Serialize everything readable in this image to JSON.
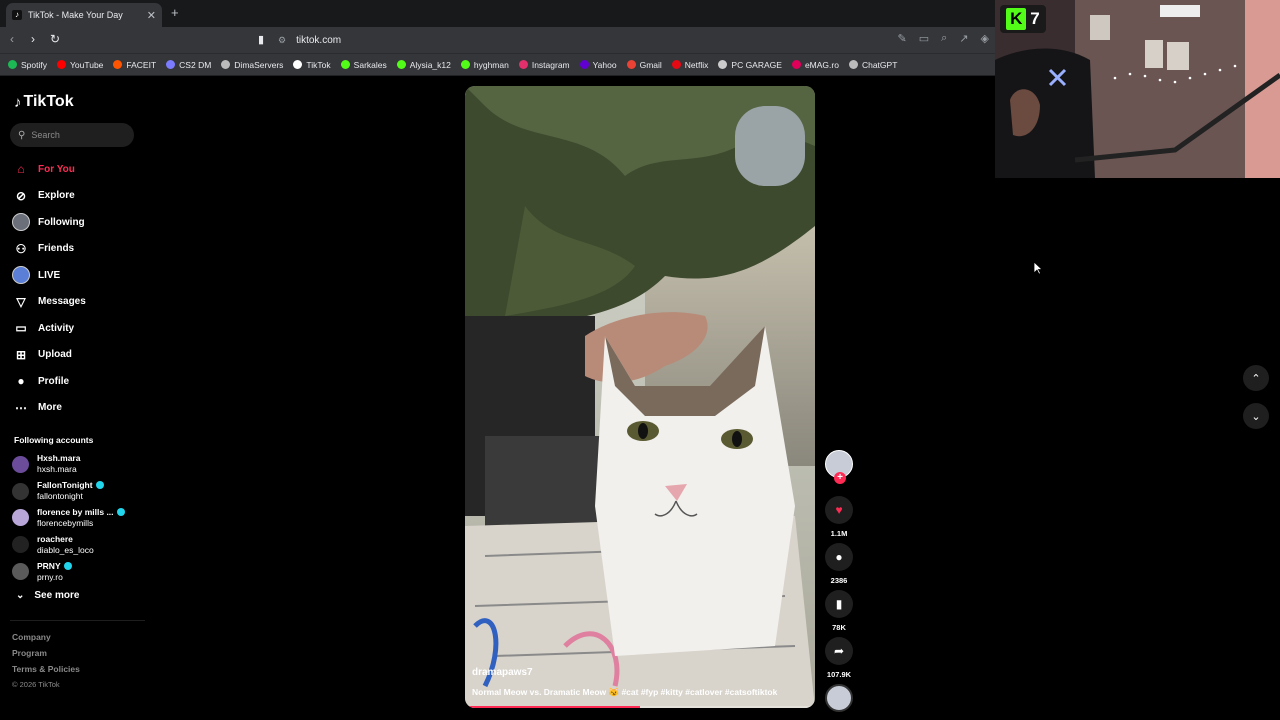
{
  "browser": {
    "tab_title": "TikTok - Make Your Day",
    "url": "tiktok.com",
    "bookmarks": [
      {
        "label": "Spotify",
        "color": "#1db954"
      },
      {
        "label": "YouTube",
        "color": "#ff0000"
      },
      {
        "label": "FACEIT",
        "color": "#ff5500"
      },
      {
        "label": "CS2 DM",
        "color": "#7b7bff"
      },
      {
        "label": "DimaServers",
        "color": "#bbbbbb"
      },
      {
        "label": "TikTok",
        "color": "#ffffff"
      },
      {
        "label": "Sarkales",
        "color": "#53fc18"
      },
      {
        "label": "Alysia_k12",
        "color": "#53fc18"
      },
      {
        "label": "hyghman",
        "color": "#53fc18"
      },
      {
        "label": "Instagram",
        "color": "#e1306c"
      },
      {
        "label": "Yahoo",
        "color": "#6001d2"
      },
      {
        "label": "Gmail",
        "color": "#ea4335"
      },
      {
        "label": "Netflix",
        "color": "#e50914"
      },
      {
        "label": "PC GARAGE",
        "color": "#cccccc"
      },
      {
        "label": "eMAG.ro",
        "color": "#e0005a"
      },
      {
        "label": "ChatGPT",
        "color": "#bbbbbb"
      }
    ]
  },
  "sidebar": {
    "logo": "TikTok",
    "search_placeholder": "Search",
    "menu": [
      {
        "label": "For You",
        "icon": "home-icon",
        "active": true
      },
      {
        "label": "Explore",
        "icon": "compass-icon"
      },
      {
        "label": "Following",
        "icon": "avatar-icon"
      },
      {
        "label": "Friends",
        "icon": "friends-icon"
      },
      {
        "label": "LIVE",
        "icon": "live-icon"
      },
      {
        "label": "Messages",
        "icon": "send-icon"
      },
      {
        "label": "Activity",
        "icon": "activity-icon"
      },
      {
        "label": "Upload",
        "icon": "upload-icon"
      },
      {
        "label": "Profile",
        "icon": "profile-icon"
      },
      {
        "label": "More",
        "icon": "more-icon"
      }
    ],
    "following_title": "Following accounts",
    "following": [
      {
        "name": "Hxsh.mara",
        "handle": "hxsh.mara",
        "verified": false,
        "color": "#6b4c9a"
      },
      {
        "name": "FallonTonight",
        "handle": "fallontonight",
        "verified": true,
        "color": "#333333"
      },
      {
        "name": "florence by mills ...",
        "handle": "florencebymills",
        "verified": true,
        "color": "#b8a6d9"
      },
      {
        "name": "roachere",
        "handle": "diablo_es_loco",
        "verified": false,
        "color": "#222222"
      },
      {
        "name": "PRNY",
        "handle": "prny.ro",
        "verified": true,
        "color": "#5a5a5a"
      }
    ],
    "see_more": "See more",
    "footer": {
      "company": "Company",
      "program": "Program",
      "terms": "Terms & Policies",
      "copyright": "© 2026 TikTok"
    }
  },
  "video": {
    "username": "dramapaws7",
    "caption": "Normal Meow vs. Dramatic Meow 😼 #cat #fyp #kitty #catlover #catsoftiktok",
    "progress": 0.5
  },
  "actions": {
    "likes": "1.1M",
    "comments": "2386",
    "saves": "78K",
    "shares": "107.9K"
  },
  "overlay": {
    "badge_number": "7"
  }
}
